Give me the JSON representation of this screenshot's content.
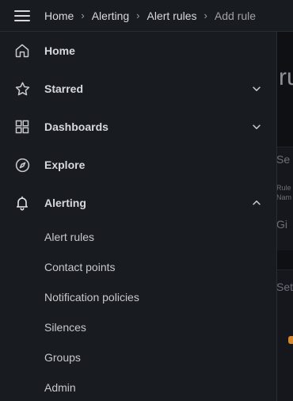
{
  "breadcrumb": {
    "items": [
      "Home",
      "Alerting",
      "Alert rules"
    ],
    "current": "Add rule"
  },
  "sidebar": {
    "items": [
      {
        "label": "Home",
        "icon": "home-icon"
      },
      {
        "label": "Starred",
        "icon": "star-icon",
        "expandable": true,
        "expanded": false
      },
      {
        "label": "Dashboards",
        "icon": "dashboards-grid-icon",
        "expandable": true,
        "expanded": false
      },
      {
        "label": "Explore",
        "icon": "compass-icon"
      },
      {
        "label": "Alerting",
        "icon": "bell-icon",
        "expandable": true,
        "expanded": true
      }
    ],
    "alerting_children": [
      "Alert rules",
      "Contact points",
      "Notification policies",
      "Silences",
      "Groups",
      "Admin"
    ]
  },
  "background": {
    "title_fragment": "ru",
    "section1_fragment": "Se",
    "rule_label_fragment": "Rule",
    "name_fragment": "Nam",
    "field_fragment": "Gi",
    "section2_fragment": "Set"
  },
  "colors": {
    "sidebar_bg": "#181b1f",
    "page_bg": "#111217",
    "text_primary": "#d8d9dc",
    "text_secondary": "#9fa1a7",
    "accent_orange": "#d6882f"
  }
}
